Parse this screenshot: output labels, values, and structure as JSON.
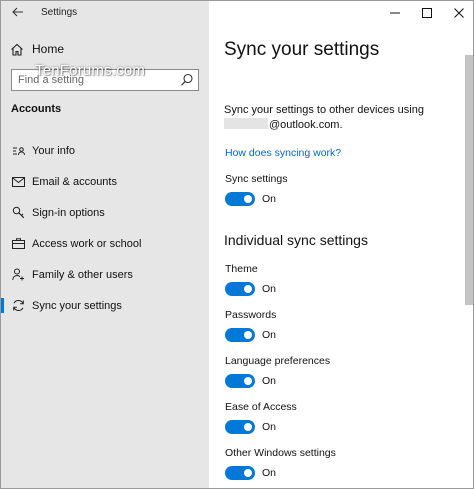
{
  "window": {
    "app_title": "Settings",
    "watermark": "TenForums.com"
  },
  "sidebar": {
    "home_label": "Home",
    "search_placeholder": "Find a setting",
    "section_title": "Accounts",
    "items": [
      {
        "label": "Your info",
        "icon": "person-card-icon",
        "active": false
      },
      {
        "label": "Email & accounts",
        "icon": "mail-icon",
        "active": false
      },
      {
        "label": "Sign-in options",
        "icon": "key-icon",
        "active": false
      },
      {
        "label": "Access work or school",
        "icon": "briefcase-icon",
        "active": false
      },
      {
        "label": "Family & other users",
        "icon": "add-person-icon",
        "active": false
      },
      {
        "label": "Sync your settings",
        "icon": "sync-icon",
        "active": true
      }
    ]
  },
  "main": {
    "title": "Sync your settings",
    "description_prefix": "Sync your settings to other devices using",
    "account_email_suffix": "@outlook.com.",
    "link": "How does syncing work?",
    "sync_settings": {
      "label": "Sync settings",
      "state": "On"
    },
    "individual_heading": "Individual sync settings",
    "individual": [
      {
        "label": "Theme",
        "state": "On"
      },
      {
        "label": "Passwords",
        "state": "On"
      },
      {
        "label": "Language preferences",
        "state": "On"
      },
      {
        "label": "Ease of Access",
        "state": "On"
      },
      {
        "label": "Other Windows settings",
        "state": "On"
      }
    ]
  },
  "colors": {
    "accent": "#0078d7",
    "sidebar_bg": "#e6e6e6",
    "link": "#0066cc"
  }
}
